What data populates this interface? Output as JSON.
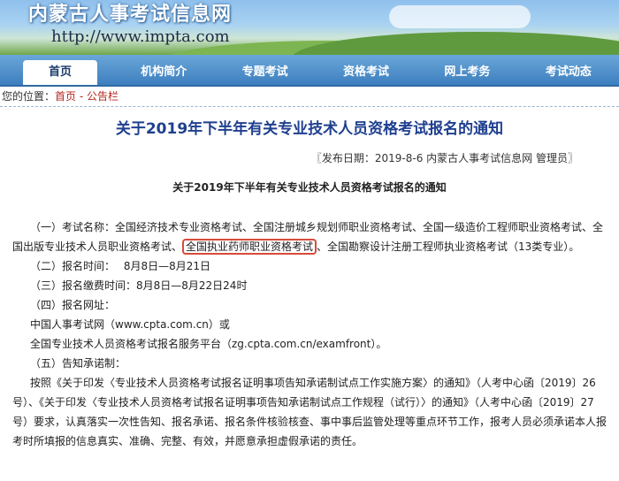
{
  "site": {
    "title": "内蒙古人事考试信息网",
    "url": "http://www.impta.com"
  },
  "nav": [
    "首页",
    "机构简介",
    "专题考试",
    "资格考试",
    "网上考务",
    "考试动态"
  ],
  "breadcrumb": {
    "label": "您的位置：",
    "home": "首页",
    "sep": " - ",
    "current": "公告栏"
  },
  "article": {
    "title": "关于2019年下半年有关专业技术人员资格考试报名的通知",
    "meta": "〖发布日期：2019-8-6 内蒙古人事考试信息网 管理员〗",
    "subtitle": "关于2019年下半年有关专业技术人员资格考试报名的通知",
    "p1_head": "（一）考试名称：全国经济技术专业资格考试、全国注册城乡规划师职业资格考试、全国一级造价工程师职业资格考试、全国出版专业技术人员职业资格考试、",
    "p1_highlight": "全国执业药师职业资格考试",
    "p1_tail": "、全国勘察设计注册工程师执业资格考试（13类专业）。",
    "p2": "（二）报名时间：　 8月8日—8月21日",
    "p3": "（三）报名缴费时间：8月8日—8月22日24时",
    "p4": "（四）报名网址：",
    "p4a": "中国人事考试网（www.cpta.com.cn）或",
    "p4b": "全国专业技术人员资格考试报名服务平台（zg.cpta.com.cn/examfront）。",
    "p5": "（五）告知承诺制：",
    "p6": "按照《关于印发〈专业技术人员资格考试报名证明事项告知承诺制试点工作实施方案〉的通知》（人考中心函〔2019〕26号）、《关于印发〈专业技术人员资格考试报名证明事项告知承诺制试点工作规程（试行）〉的通知》（人考中心函〔2019〕27号）要求，认真落实一次性告知、报名承诺、报名条件核验核查、事中事后监管处理等重点环节工作，报考人员必须承诺本人报考时所填报的信息真实、准确、完整、有效，并愿意承担虚假承诺的责任。"
  },
  "colors": {
    "nav_bg": "#3d7fbf",
    "title_blue": "#1f3f8f",
    "link_red": "#b3261e",
    "highlight_red": "#d84b3a"
  }
}
